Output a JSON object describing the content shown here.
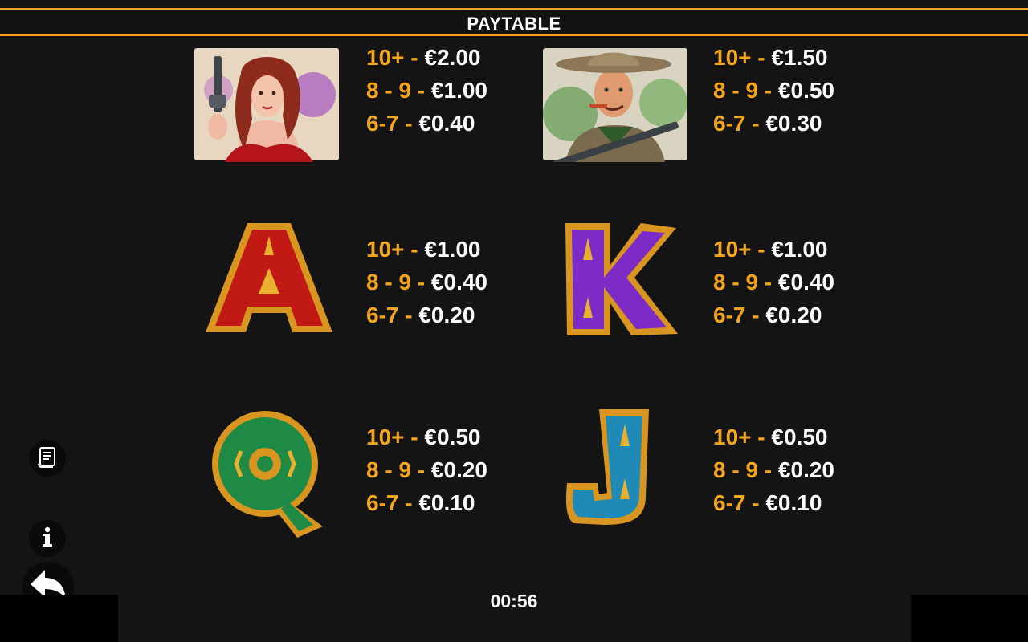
{
  "header": {
    "title": "PAYTABLE"
  },
  "colors": {
    "accent": "#f3a51d",
    "background": "#141414"
  },
  "symbols": [
    {
      "name": "woman-portrait",
      "pays": [
        {
          "count": "10+ - ",
          "amount": "€2.00"
        },
        {
          "count": "8 - 9 - ",
          "amount": "€1.00"
        },
        {
          "count": "6-7 - ",
          "amount": "€0.40"
        }
      ]
    },
    {
      "name": "cowboy-portrait",
      "pays": [
        {
          "count": "10+ - ",
          "amount": "€1.50"
        },
        {
          "count": "8 - 9 - ",
          "amount": "€0.50"
        },
        {
          "count": "6-7 - ",
          "amount": "€0.30"
        }
      ]
    },
    {
      "name": "letter-a",
      "pays": [
        {
          "count": "10+ - ",
          "amount": "€1.00"
        },
        {
          "count": "8 - 9 - ",
          "amount": "€0.40"
        },
        {
          "count": "6-7 - ",
          "amount": "€0.20"
        }
      ]
    },
    {
      "name": "letter-k",
      "pays": [
        {
          "count": "10+ - ",
          "amount": "€1.00"
        },
        {
          "count": "8 - 9 - ",
          "amount": "€0.40"
        },
        {
          "count": "6-7 - ",
          "amount": "€0.20"
        }
      ]
    },
    {
      "name": "letter-q",
      "pays": [
        {
          "count": "10+ - ",
          "amount": "€0.50"
        },
        {
          "count": "8 - 9 - ",
          "amount": "€0.20"
        },
        {
          "count": "6-7 - ",
          "amount": "€0.10"
        }
      ]
    },
    {
      "name": "letter-j",
      "pays": [
        {
          "count": "10+ - ",
          "amount": "€0.50"
        },
        {
          "count": "8 - 9 - ",
          "amount": "€0.20"
        },
        {
          "count": "6-7 - ",
          "amount": "€0.10"
        }
      ]
    }
  ],
  "side_buttons": {
    "paytable_icon": "scroll-icon",
    "info_icon": "info-icon",
    "back_icon": "back-arrow-icon"
  },
  "footer": {
    "timer": "00:56"
  }
}
